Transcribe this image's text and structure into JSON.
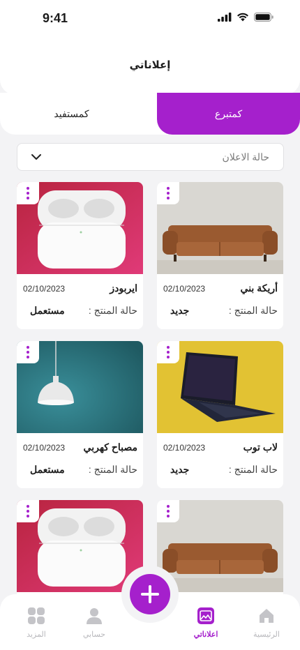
{
  "status_bar": {
    "time": "9:41"
  },
  "header": {
    "title": "إعلاناتي"
  },
  "tabs": {
    "donor": "كمتبرع",
    "beneficiary": "كمستفيد"
  },
  "filter": {
    "label": "حالة الاعلان"
  },
  "cards": [
    {
      "name": "أريكة بني",
      "date": "02/10/2023",
      "status_label": "حالة المنتج :",
      "status_value": "جديد",
      "image": "sofa"
    },
    {
      "name": "ايربودز",
      "date": "02/10/2023",
      "status_label": "حالة المنتج :",
      "status_value": "مستعمل",
      "image": "airpods"
    },
    {
      "name": "لاب توب",
      "date": "02/10/2023",
      "status_label": "حالة المنتج :",
      "status_value": "جديد",
      "image": "laptop"
    },
    {
      "name": "مصباح كهربي",
      "date": "02/10/2023",
      "status_label": "حالة المنتج :",
      "status_value": "مستعمل",
      "image": "lamp"
    },
    {
      "image": "sofa"
    },
    {
      "image": "airpods"
    }
  ],
  "nav": {
    "home": "الرئيسية",
    "my_ads": "اعلاناتي",
    "account": "حسابي",
    "more": "المزيد"
  },
  "colors": {
    "accent": "#a520cc",
    "inactive": "#b8b8bc",
    "background": "#f3f3f5"
  }
}
